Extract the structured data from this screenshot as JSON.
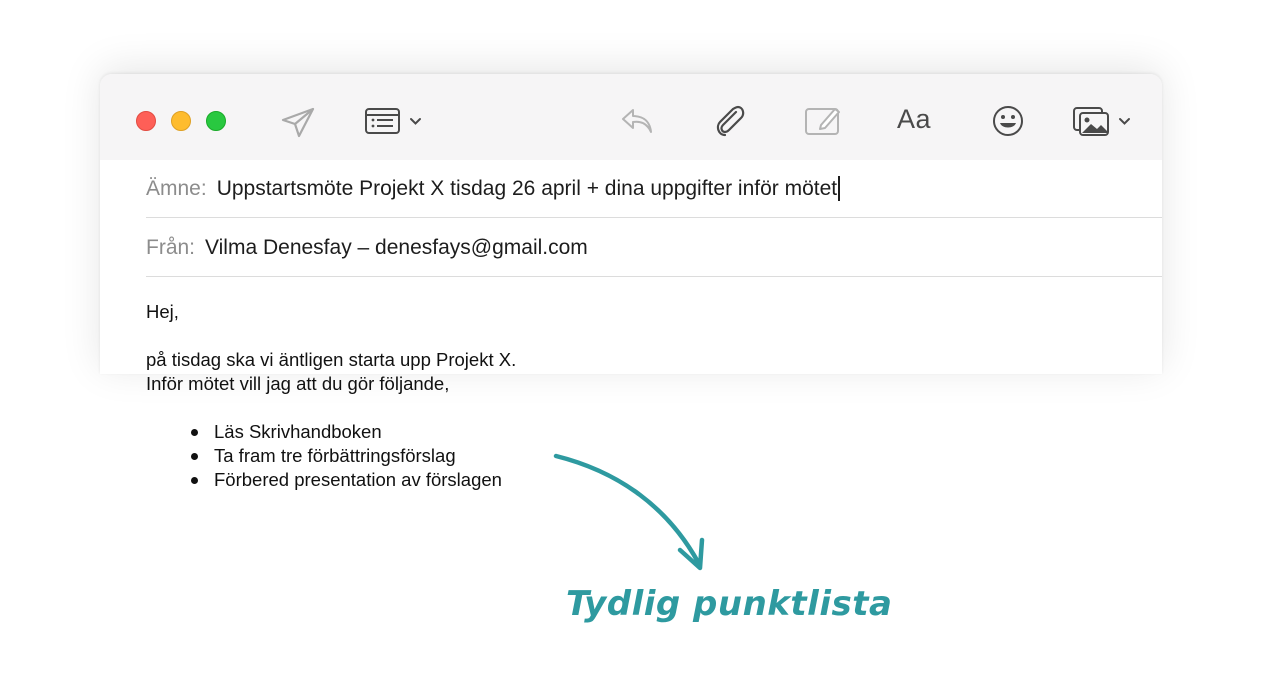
{
  "toolbar": {
    "icons": [
      "send-icon",
      "header-list-icon",
      "reply-icon",
      "attachment-icon",
      "markup-icon",
      "font-icon",
      "emoji-icon",
      "photo-browser-icon"
    ],
    "font_label": "Aa"
  },
  "compose": {
    "subject_label": "Ämne:",
    "subject_value": "Uppstartsmöte Projekt X tisdag 26 april + dina uppgifter inför mötet",
    "from_label": "Från:",
    "from_value": "Vilma Denesfay – denesfays@gmail.com"
  },
  "body": {
    "greeting": "Hej,",
    "line1": "på tisdag ska vi äntligen starta upp Projekt X.",
    "line2": "Inför mötet vill jag att du gör följande,",
    "bullets": [
      "Läs Skrivhandboken",
      "Ta fram tre förbättringsförslag",
      "Förbered presentation av förslagen"
    ]
  },
  "annotation": {
    "text": "Tydlig punktlista",
    "color": "#2e9aa0"
  }
}
